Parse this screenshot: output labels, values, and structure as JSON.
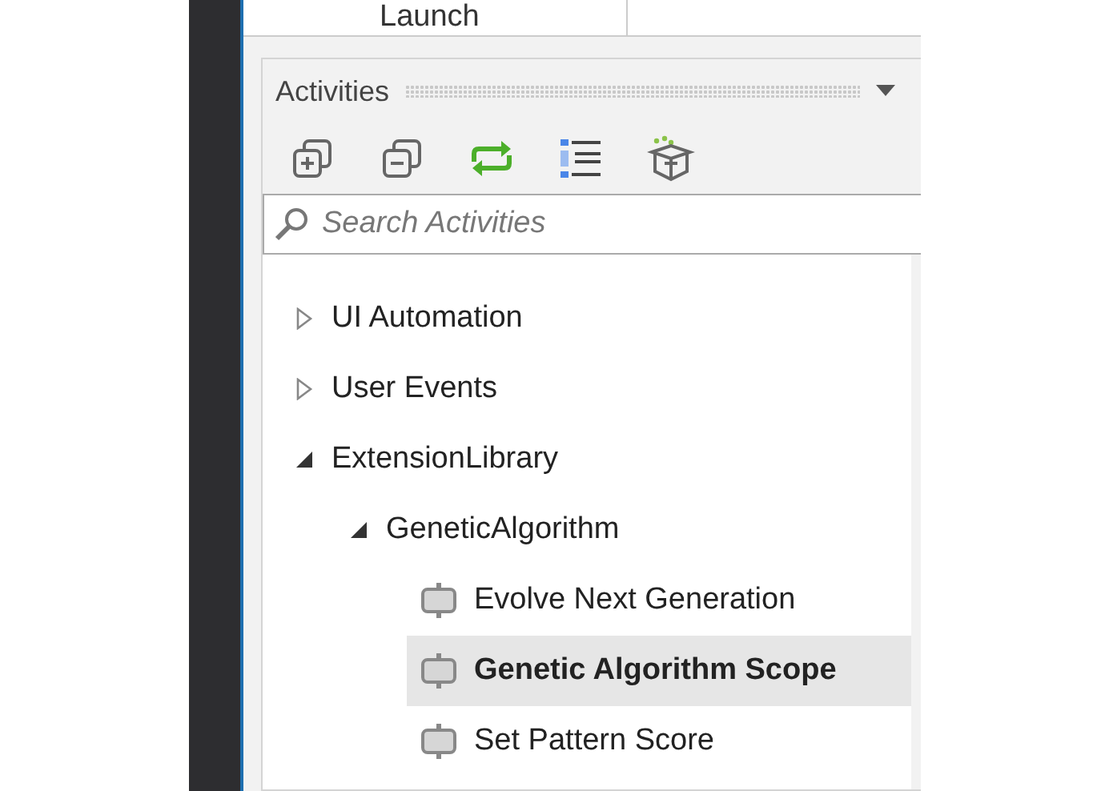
{
  "top_tab": {
    "label": "Launch"
  },
  "activities_panel": {
    "title": "Activities",
    "toolbar": [
      {
        "kind": "expand"
      },
      {
        "kind": "collapse"
      },
      {
        "kind": "refresh"
      },
      {
        "kind": "list"
      },
      {
        "kind": "package"
      }
    ],
    "search": {
      "placeholder": "Search Activities"
    },
    "tree": [
      {
        "label": "UI Automation",
        "expanded": false
      },
      {
        "label": "User Events",
        "expanded": false
      },
      {
        "label": "ExtensionLibrary",
        "expanded": true,
        "children": [
          {
            "label": "GeneticAlgorithm",
            "expanded": true,
            "children": [
              {
                "label": "Evolve Next Generation",
                "kind": "activity",
                "selected": false
              },
              {
                "label": "Genetic Algorithm Scope",
                "kind": "activity",
                "selected": true
              },
              {
                "label": "Set Pattern Score",
                "kind": "activity",
                "selected": false
              }
            ]
          }
        ]
      }
    ]
  }
}
